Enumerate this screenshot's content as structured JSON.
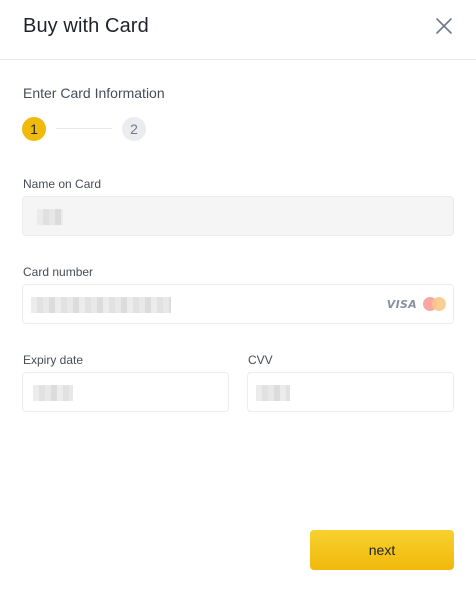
{
  "dialog": {
    "title": "Buy with Card",
    "close_icon": "close-icon"
  },
  "form": {
    "section_label": "Enter Card Information",
    "steps": [
      {
        "label": "1",
        "active": true
      },
      {
        "label": "2",
        "active": false
      }
    ],
    "name_on_card": {
      "label": "Name on Card",
      "value": ""
    },
    "card_number": {
      "label": "Card number",
      "value": "",
      "brands": [
        "VISA",
        "mastercard-icon"
      ]
    },
    "expiry_date": {
      "label": "Expiry date",
      "value": ""
    },
    "cvv": {
      "label": "CVV",
      "value": ""
    }
  },
  "actions": {
    "next_label": "next"
  },
  "colors": {
    "accent": "#f0b90b",
    "text": "#1e2329",
    "muted": "#474d57",
    "border": "#eaecef"
  }
}
